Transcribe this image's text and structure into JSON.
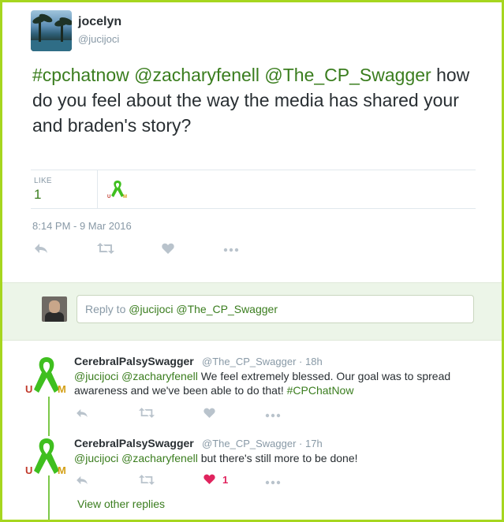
{
  "main_tweet": {
    "display_name": "jocelyn",
    "handle": "@jucijoci",
    "text_parts": {
      "hashtag": "#cpchatnow",
      "mention1": "@zacharyfenell",
      "mention2": "@The_CP_Swagger",
      "body": "how do you feel about the way the media has shared your and braden's story?"
    },
    "like_label": "LIKE",
    "like_count": "1",
    "timestamp": "8:14 PM - 9 Mar 2016"
  },
  "reply_box": {
    "prefix": "Reply to",
    "mention1": "@jucijoci",
    "mention2": "@The_CP_Swagger"
  },
  "replies": [
    {
      "display_name": "CerebralPalsySwagger",
      "handle_time": "@The_CP_Swagger · 18h",
      "mention1": "@jucijoci",
      "mention2": "@zacharyfenell",
      "body": "We feel extremely blessed. Our goal was to spread awareness and we've been able to do that!",
      "hashtag": "#CPChatNow",
      "like_count": ""
    },
    {
      "display_name": "CerebralPalsySwagger",
      "handle_time": "@The_CP_Swagger · 17h",
      "mention1": "@jucijoci",
      "mention2": "@zacharyfenell",
      "body": "but there's still more to be done!",
      "hashtag": "",
      "like_count": "1"
    }
  ],
  "view_other_replies": "View other replies",
  "colors": {
    "frame": "#a6d61f",
    "link_green": "#3a7d1e",
    "ribbon_green": "#3fbf1f",
    "like_red": "#e0245e",
    "muted": "#8899a6"
  },
  "icons": [
    "reply-icon",
    "retweet-icon",
    "heart-icon",
    "more-icon",
    "green-ribbon-icon"
  ]
}
